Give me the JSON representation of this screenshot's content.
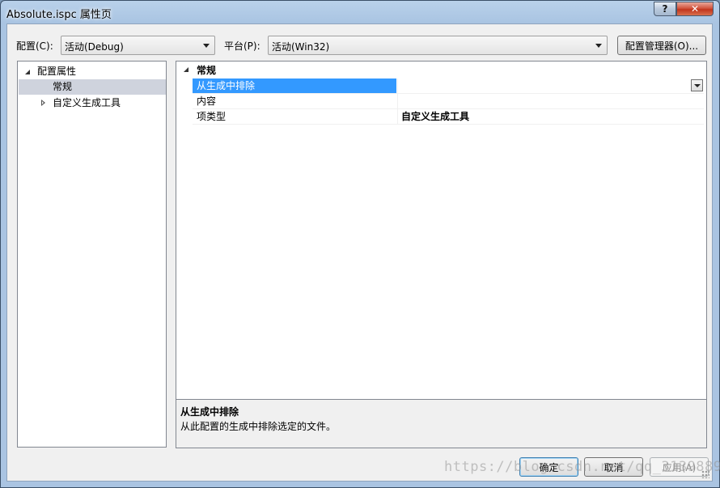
{
  "window": {
    "title": "Absolute.ispc 属性页",
    "help_glyph": "?",
    "close_glyph": "✕"
  },
  "toolbar": {
    "config_label": "配置(C):",
    "config_value": "活动(Debug)",
    "platform_label": "平台(P):",
    "platform_value": "活动(Win32)",
    "config_manager_label": "配置管理器(O)..."
  },
  "tree": {
    "root": "配置属性",
    "items": [
      {
        "label": "常规",
        "selected": true
      },
      {
        "label": "自定义生成工具",
        "selected": false
      }
    ]
  },
  "grid": {
    "category": "常规",
    "rows": [
      {
        "name": "从生成中排除",
        "value": "",
        "selected": true
      },
      {
        "name": "内容",
        "value": ""
      },
      {
        "name": "项类型",
        "value": "自定义生成工具"
      }
    ]
  },
  "description": {
    "title": "从生成中排除",
    "text": "从此配置的生成中排除选定的文件。"
  },
  "buttons": {
    "ok": "确定",
    "cancel": "取消",
    "apply": "应用(A)"
  },
  "watermark": "https://blog.csdn.net/qq_31398891"
}
